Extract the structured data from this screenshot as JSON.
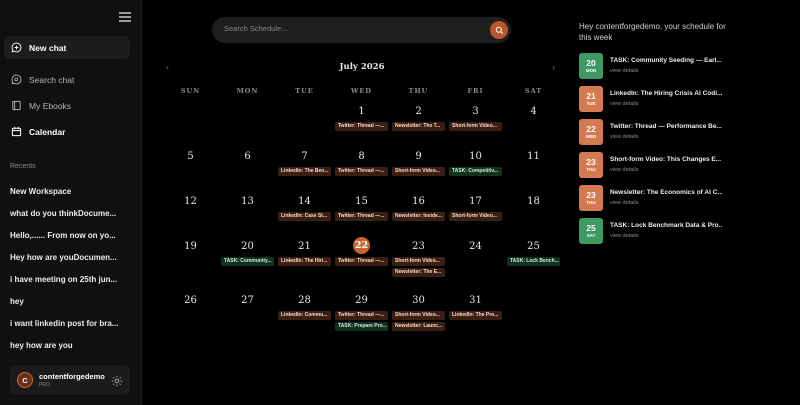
{
  "sidebar": {
    "new_chat": "New chat",
    "search_chat": "Search chat",
    "my_ebooks": "My Ebooks",
    "calendar": "Calendar",
    "recents_label": "Recents",
    "recents": [
      "New Workspace",
      "what do you thinkDocume...",
      "Hello,...... From now on yo...",
      "Hey how are youDocumen...",
      "i have meeting on 25th jun...",
      "hey",
      "i want linkedin post for bra...",
      "hey how are you"
    ],
    "user": {
      "initial": "C",
      "name": "contentforgedemo",
      "plan": "PRO"
    }
  },
  "search": {
    "placeholder": "Search Schedule..."
  },
  "calendar": {
    "month_label": "July 2026",
    "weekdays": [
      "SUN",
      "MON",
      "TUE",
      "WED",
      "THU",
      "FRI",
      "SAT"
    ],
    "today": "22",
    "weeks": [
      [
        {
          "day": ""
        },
        {
          "day": ""
        },
        {
          "day": ""
        },
        {
          "day": "1",
          "events": [
            {
              "label": "Twitter: Thread —...",
              "color": "brown"
            }
          ]
        },
        {
          "day": "2",
          "events": [
            {
              "label": "Newsletter: The T...",
              "color": "brown"
            }
          ]
        },
        {
          "day": "3",
          "events": [
            {
              "label": "Short-form Video...",
              "color": "brown"
            }
          ]
        },
        {
          "day": "4"
        }
      ],
      [
        {
          "day": "5"
        },
        {
          "day": "6"
        },
        {
          "day": "7",
          "events": [
            {
              "label": "LinkedIn: The Ben...",
              "color": "brown"
            }
          ]
        },
        {
          "day": "8",
          "events": [
            {
              "label": "Twitter: Thread —...",
              "color": "brown"
            }
          ]
        },
        {
          "day": "9",
          "events": [
            {
              "label": "Short-form Video...",
              "color": "brown"
            }
          ]
        },
        {
          "day": "10",
          "events": [
            {
              "label": "TASK: Competitiv...",
              "color": "green"
            }
          ]
        },
        {
          "day": "11"
        }
      ],
      [
        {
          "day": "12"
        },
        {
          "day": "13"
        },
        {
          "day": "14",
          "events": [
            {
              "label": "LinkedIn: Case St...",
              "color": "brown"
            }
          ]
        },
        {
          "day": "15",
          "events": [
            {
              "label": "Twitter: Thread —...",
              "color": "brown"
            }
          ]
        },
        {
          "day": "16",
          "events": [
            {
              "label": "Newsletter: Inside...",
              "color": "brown"
            }
          ]
        },
        {
          "day": "17",
          "events": [
            {
              "label": "Short-form Video...",
              "color": "brown"
            }
          ]
        },
        {
          "day": "18"
        }
      ],
      [
        {
          "day": "19"
        },
        {
          "day": "20",
          "events": [
            {
              "label": "TASK: Community...",
              "color": "green"
            }
          ]
        },
        {
          "day": "21",
          "events": [
            {
              "label": "LinkedIn: The Hiri...",
              "color": "brown"
            }
          ]
        },
        {
          "day": "22",
          "events": [
            {
              "label": "Twitter: Thread —...",
              "color": "brown"
            }
          ]
        },
        {
          "day": "23",
          "events": [
            {
              "label": "Short-form Video...",
              "color": "brown"
            },
            {
              "label": "Newsletter: The E...",
              "color": "brown"
            }
          ]
        },
        {
          "day": "24"
        },
        {
          "day": "25",
          "events": [
            {
              "label": "TASK: Lock Bench...",
              "color": "green"
            }
          ]
        }
      ],
      [
        {
          "day": "26"
        },
        {
          "day": "27"
        },
        {
          "day": "28",
          "events": [
            {
              "label": "LinkedIn: Commu...",
              "color": "brown"
            }
          ]
        },
        {
          "day": "29",
          "events": [
            {
              "label": "Twitter: Thread —...",
              "color": "brown"
            },
            {
              "label": "TASK: Prepare Pro...",
              "color": "green"
            }
          ]
        },
        {
          "day": "30",
          "events": [
            {
              "label": "Short-form Video...",
              "color": "brown"
            },
            {
              "label": "Newsletter: Launc...",
              "color": "brown"
            }
          ]
        },
        {
          "day": "31",
          "events": [
            {
              "label": "LinkedIn: The Pro...",
              "color": "brown"
            }
          ]
        },
        {
          "day": ""
        }
      ]
    ]
  },
  "schedule": {
    "heading": "Hey contentforgedemo, your schedule for this week",
    "link_label": "view details",
    "items": [
      {
        "day": "20",
        "dow": "MON",
        "title": "TASK: Community Seeding — Earl...",
        "color": "green"
      },
      {
        "day": "21",
        "dow": "TUE",
        "title": "LinkedIn: The Hiring Crisis AI Codi...",
        "color": "orange"
      },
      {
        "day": "22",
        "dow": "WED",
        "title": "Twitter: Thread — Performance Be...",
        "color": "orange"
      },
      {
        "day": "23",
        "dow": "THU",
        "title": "Short-form Video: This Changes E...",
        "color": "orange"
      },
      {
        "day": "23",
        "dow": "THU",
        "title": "Newsletter: The Economics of AI C...",
        "color": "orange"
      },
      {
        "day": "25",
        "dow": "SAT",
        "title": "TASK: Lock Benchmark Data & Pro...",
        "color": "green"
      }
    ]
  },
  "colors": {
    "accent": "#c7642f",
    "event_brown": "#3a2014",
    "event_green": "#14311f",
    "badge_green": "#3e9a60",
    "badge_orange": "#d47a52"
  }
}
